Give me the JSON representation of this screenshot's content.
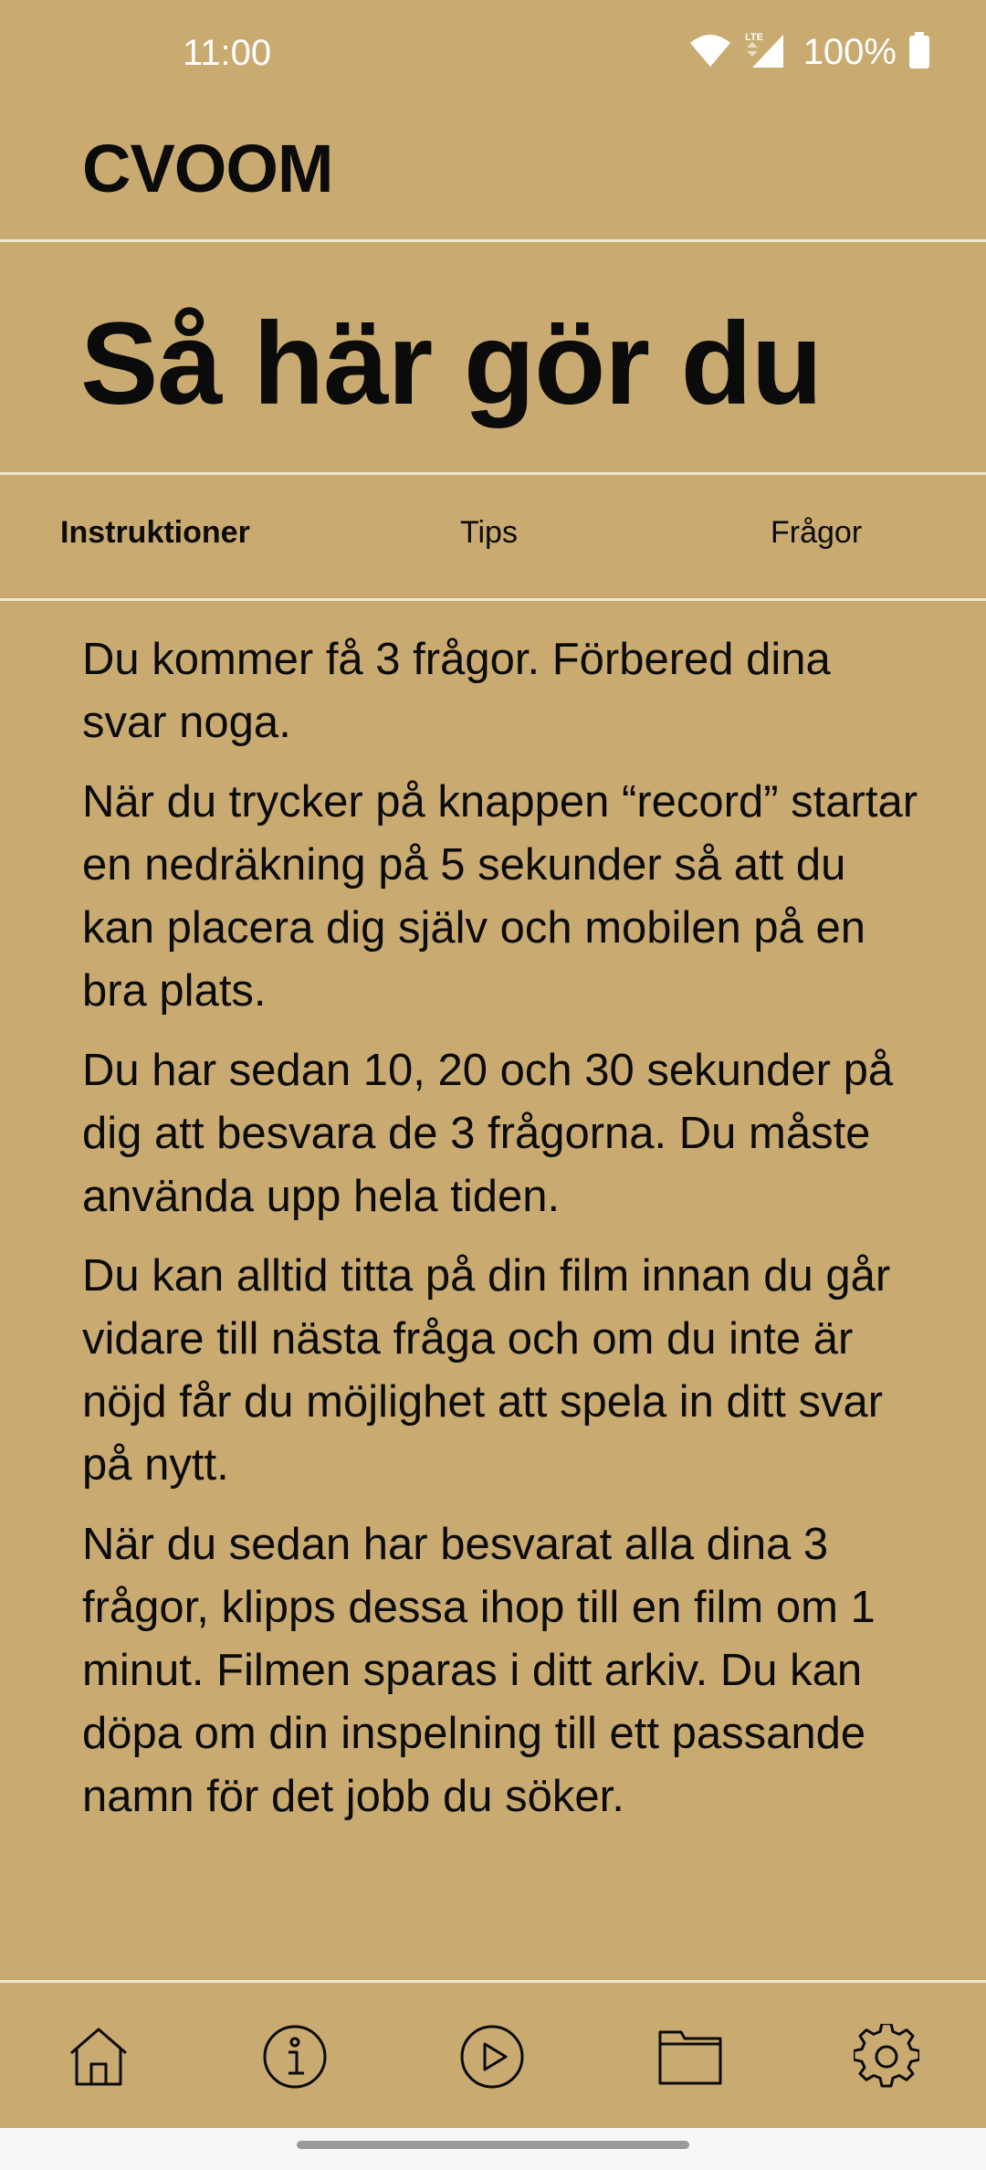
{
  "status_bar": {
    "time": "11:00",
    "network": "LTE",
    "battery": "100%"
  },
  "header": {
    "logo": "CVOOM"
  },
  "page": {
    "title": "Så här gör du"
  },
  "tabs": [
    {
      "label": "Instruktioner",
      "active": true
    },
    {
      "label": "Tips",
      "active": false
    },
    {
      "label": "Frågor",
      "active": false
    }
  ],
  "content": {
    "paragraphs": [
      "Du kommer få 3 frågor. Förbered dina svar noga.",
      "När du trycker på knappen “record” startar en nedräkning på 5 sekunder så att du kan placera dig själv och mobilen på en bra plats.",
      "Du har sedan 10, 20 och 30 sekunder på dig att besvara de 3 frågorna. Du måste använda upp hela tiden.",
      "Du kan alltid titta på din film innan du går vidare till nästa fråga och om du inte är nöjd får du möjlighet att spela in ditt svar på nytt.",
      "När du sedan har besvarat alla dina 3 frågor, klipps dessa ihop till en film om 1 minut. Filmen sparas i ditt arkiv. Du kan döpa om din inspelning till ett passande namn för det jobb du söker."
    ]
  },
  "bottom_nav": [
    {
      "icon": "home-icon"
    },
    {
      "icon": "info-icon"
    },
    {
      "icon": "play-icon"
    },
    {
      "icon": "folder-icon"
    },
    {
      "icon": "gear-icon"
    }
  ],
  "colors": {
    "background": "#c9aa71",
    "divider": "#f1e6d2",
    "text": "#0b0b0b"
  }
}
